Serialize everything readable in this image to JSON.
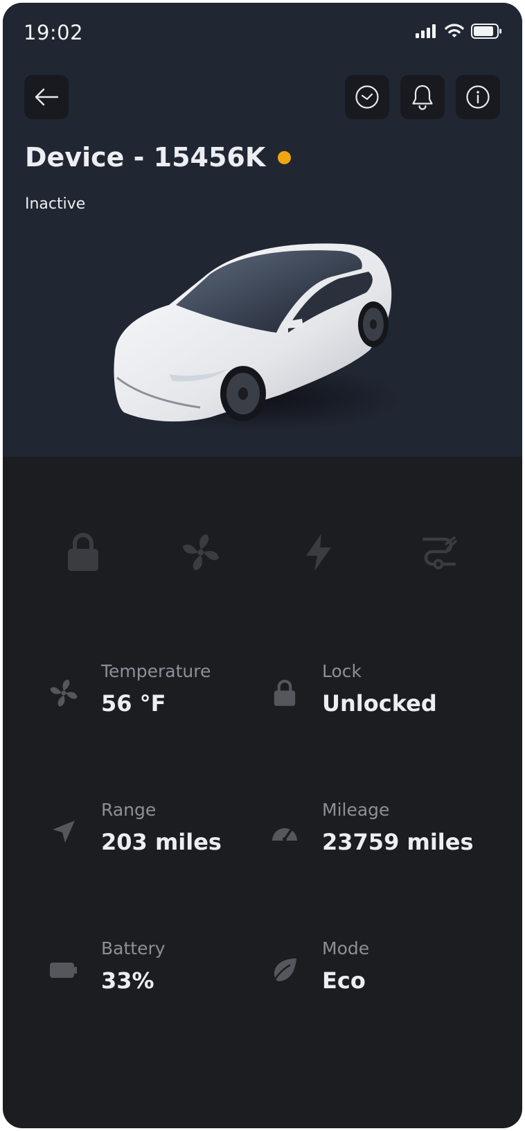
{
  "status_bar": {
    "time": "19:02",
    "icons": [
      "signal-icon",
      "wifi-icon",
      "battery-icon"
    ]
  },
  "header": {
    "buttons": [
      "back-arrow-icon",
      "clock-icon",
      "bell-icon",
      "info-icon"
    ]
  },
  "device": {
    "title": "Device - 15456K",
    "status": "Inactive",
    "status_color": "#f0a60f"
  },
  "controls": [
    "lock-icon",
    "fan-icon",
    "lightning-icon",
    "route-icon"
  ],
  "stats": [
    {
      "label": "Temperature",
      "value": "56 °F",
      "icon": "fan-icon"
    },
    {
      "label": "Lock",
      "value": "Unlocked",
      "icon": "lock-icon"
    },
    {
      "label": "Range",
      "value": "203 miles",
      "icon": "navigation-arrow-icon"
    },
    {
      "label": "Mileage",
      "value": "23759 miles",
      "icon": "speedometer-icon"
    },
    {
      "label": "Battery",
      "value": "33%",
      "icon": "battery-icon"
    },
    {
      "label": "Mode",
      "value": "Eco",
      "icon": "leaf-icon"
    }
  ],
  "colors": {
    "hero_background": "#212633",
    "page_background": "#1c1d21",
    "button_background": "#181a1f",
    "control_icon": "#3a3c42",
    "stat_icon": "#55575d",
    "label_text": "#8d9098",
    "value_text": "#eceef2"
  }
}
